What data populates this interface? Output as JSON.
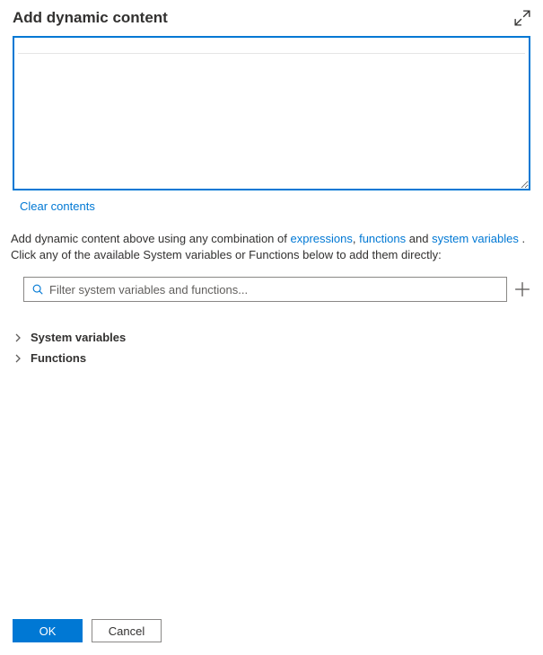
{
  "header": {
    "title": "Add dynamic content"
  },
  "editor": {
    "value": "",
    "clear_label": "Clear contents"
  },
  "hint": {
    "prefix": "Add dynamic content above using any combination of ",
    "link_expressions": "expressions",
    "comma": ", ",
    "link_functions": "functions",
    "middle": " and ",
    "link_system_variables": "system variables",
    "suffix": " . Click any of the available System variables or Functions below to add them directly:"
  },
  "search": {
    "placeholder": "Filter system variables and functions..."
  },
  "tree": {
    "system_variables": "System variables",
    "functions": "Functions"
  },
  "footer": {
    "ok": "OK",
    "cancel": "Cancel"
  }
}
